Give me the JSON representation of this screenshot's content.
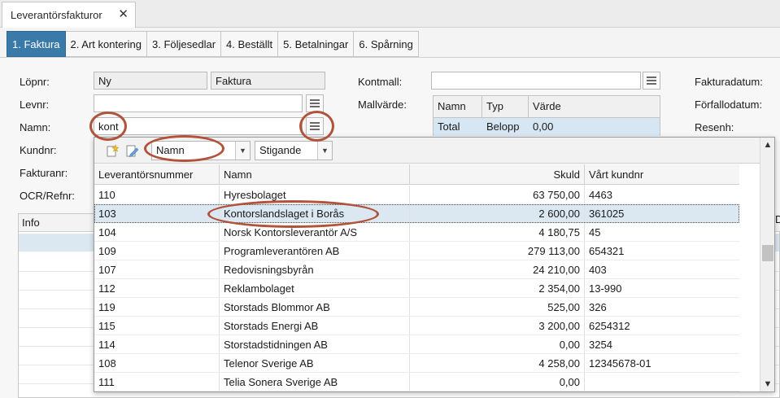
{
  "window_tab": {
    "title": "Leverantörsfakturor",
    "close": "✕"
  },
  "subtabs": [
    {
      "label": "1. Faktura",
      "active": true
    },
    {
      "label": "2. Art kontering",
      "active": false
    },
    {
      "label": "3. Följesedlar",
      "active": false
    },
    {
      "label": "4. Beställt",
      "active": false
    },
    {
      "label": "5. Betalningar",
      "active": false
    },
    {
      "label": "6. Spårning",
      "active": false
    }
  ],
  "form": {
    "lopnr_label": "Löpnr:",
    "lopnr_value": "Ny",
    "lopnr_type": "Faktura",
    "levnr_label": "Levnr:",
    "levnr_value": "",
    "namn_label": "Namn:",
    "namn_value": "kont",
    "kundnr_label": "Kundnr:",
    "fakturanr_label": "Fakturanr:",
    "ocr_label": "OCR/Refnr:",
    "kontmall_label": "Kontmall:",
    "kontmall_value": "",
    "mallvarde_label": "Mallvärde:",
    "fakturadatum_label": "Fakturadatum:",
    "forfallodatum_label": "Förfallodatum:",
    "resenh_label": "Resenh:"
  },
  "mall_table": {
    "headers": [
      "Namn",
      "Typ",
      "Värde"
    ],
    "row": [
      "Total",
      "Belopp",
      "0,00"
    ]
  },
  "info_grid": {
    "header": "Info",
    "right_fragment": "D"
  },
  "popup": {
    "sort_field": "Namn",
    "sort_order": "Stigande",
    "columns": [
      "Leverantörsnummer",
      "Namn",
      "Skuld",
      "Vårt kundnr"
    ],
    "rows": [
      {
        "nr": "110",
        "namn": "Hyresbolaget",
        "skuld": "63 750,00",
        "kundnr": "4463"
      },
      {
        "nr": "103",
        "namn": "Kontorslandslaget i Borås",
        "skuld": "2 600,00",
        "kundnr": "361025"
      },
      {
        "nr": "104",
        "namn": "Norsk Kontorsleverantör A/S",
        "skuld": "4 180,75",
        "kundnr": "45"
      },
      {
        "nr": "109",
        "namn": "Programleverantören AB",
        "skuld": "279 113,00",
        "kundnr": "654321"
      },
      {
        "nr": "107",
        "namn": "Redovisningsbyrån",
        "skuld": "24 210,00",
        "kundnr": "403"
      },
      {
        "nr": "112",
        "namn": "Reklambolaget",
        "skuld": "2 354,00",
        "kundnr": "13-990"
      },
      {
        "nr": "119",
        "namn": "Storstads Blommor AB",
        "skuld": "525,00",
        "kundnr": "326"
      },
      {
        "nr": "115",
        "namn": "Storstads Energi AB",
        "skuld": "3 200,00",
        "kundnr": "6254312"
      },
      {
        "nr": "114",
        "namn": "Storstadstidningen AB",
        "skuld": "0,00",
        "kundnr": "3254"
      },
      {
        "nr": "108",
        "namn": "Telenor Sverige AB",
        "skuld": "4 258,00",
        "kundnr": "12345678-01"
      },
      {
        "nr": "111",
        "namn": "Telia Sonera Sverige AB",
        "skuld": "0,00",
        "kundnr": ""
      }
    ],
    "selected_index": 1
  },
  "colors": {
    "accent": "#3a7aa8",
    "selection": "#dbe7f1",
    "annotation": "#b0533a"
  }
}
